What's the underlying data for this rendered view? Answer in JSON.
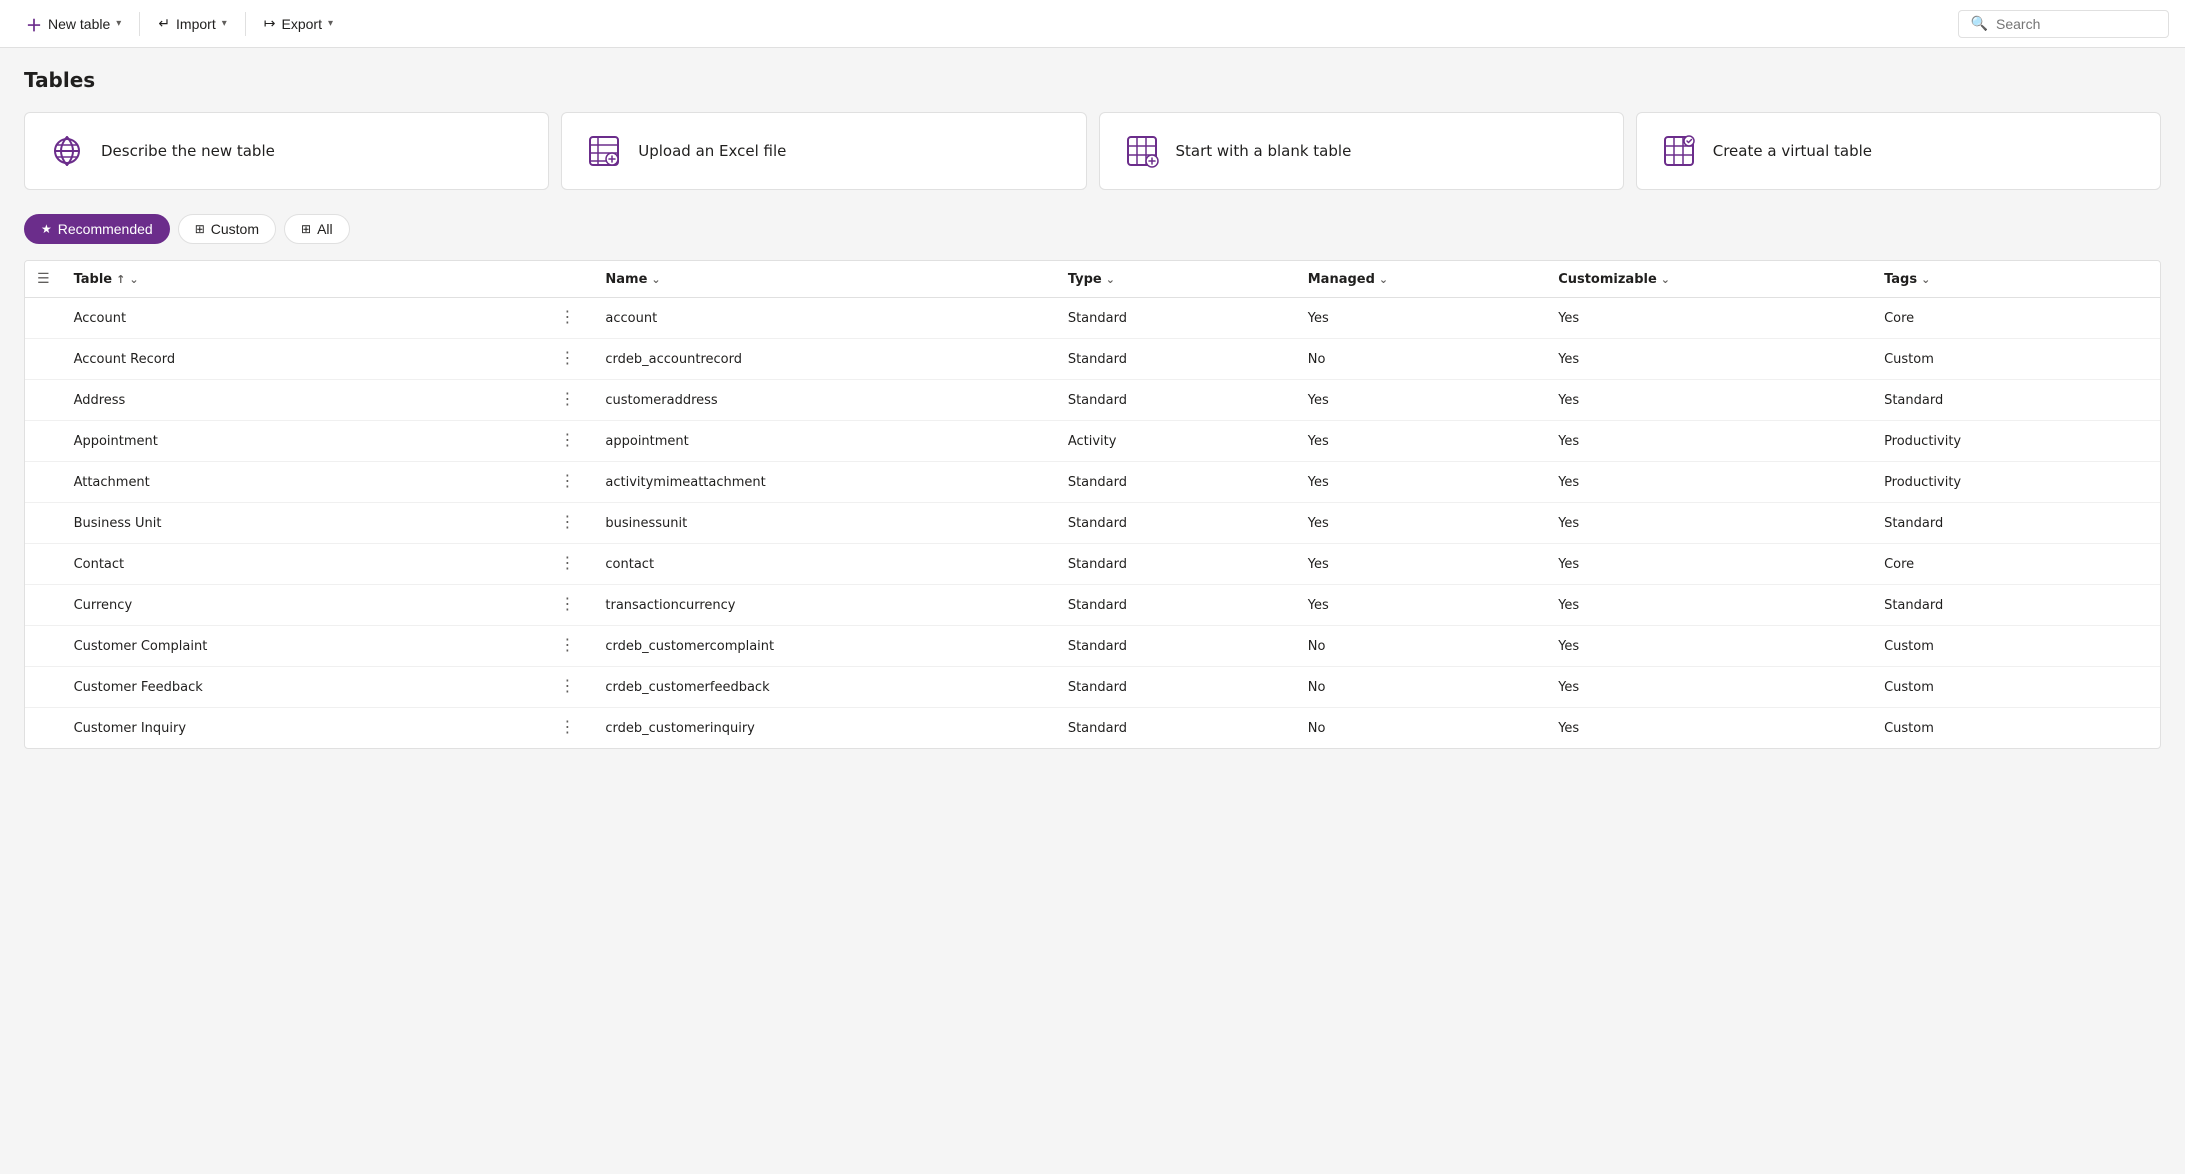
{
  "toolbar": {
    "new_table_label": "New table",
    "import_label": "Import",
    "export_label": "Export",
    "search_placeholder": "Search"
  },
  "page": {
    "title": "Tables"
  },
  "cards": [
    {
      "id": "describe",
      "label": "Describe the new table",
      "icon": "ai-icon"
    },
    {
      "id": "upload",
      "label": "Upload an Excel file",
      "icon": "excel-icon"
    },
    {
      "id": "blank",
      "label": "Start with a blank table",
      "icon": "blank-table-icon"
    },
    {
      "id": "virtual",
      "label": "Create a virtual table",
      "icon": "virtual-table-icon"
    }
  ],
  "filters": [
    {
      "id": "recommended",
      "label": "Recommended",
      "active": true
    },
    {
      "id": "custom",
      "label": "Custom",
      "active": false
    },
    {
      "id": "all",
      "label": "All",
      "active": false
    }
  ],
  "table": {
    "columns": [
      {
        "id": "table",
        "label": "Table",
        "sortable": true,
        "sort_dir": "asc"
      },
      {
        "id": "name",
        "label": "Name",
        "sortable": true
      },
      {
        "id": "type",
        "label": "Type",
        "sortable": true
      },
      {
        "id": "managed",
        "label": "Managed",
        "sortable": true
      },
      {
        "id": "customizable",
        "label": "Customizable",
        "sortable": true
      },
      {
        "id": "tags",
        "label": "Tags",
        "sortable": true
      }
    ],
    "rows": [
      {
        "table": "Account",
        "name": "account",
        "type": "Standard",
        "managed": "Yes",
        "customizable": "Yes",
        "tags": "Core"
      },
      {
        "table": "Account Record",
        "name": "crdeb_accountrecord",
        "type": "Standard",
        "managed": "No",
        "customizable": "Yes",
        "tags": "Custom"
      },
      {
        "table": "Address",
        "name": "customeraddress",
        "type": "Standard",
        "managed": "Yes",
        "customizable": "Yes",
        "tags": "Standard"
      },
      {
        "table": "Appointment",
        "name": "appointment",
        "type": "Activity",
        "managed": "Yes",
        "customizable": "Yes",
        "tags": "Productivity"
      },
      {
        "table": "Attachment",
        "name": "activitymimeattachment",
        "type": "Standard",
        "managed": "Yes",
        "customizable": "Yes",
        "tags": "Productivity"
      },
      {
        "table": "Business Unit",
        "name": "businessunit",
        "type": "Standard",
        "managed": "Yes",
        "customizable": "Yes",
        "tags": "Standard"
      },
      {
        "table": "Contact",
        "name": "contact",
        "type": "Standard",
        "managed": "Yes",
        "customizable": "Yes",
        "tags": "Core"
      },
      {
        "table": "Currency",
        "name": "transactioncurrency",
        "type": "Standard",
        "managed": "Yes",
        "customizable": "Yes",
        "tags": "Standard"
      },
      {
        "table": "Customer Complaint",
        "name": "crdeb_customercomplaint",
        "type": "Standard",
        "managed": "No",
        "customizable": "Yes",
        "tags": "Custom"
      },
      {
        "table": "Customer Feedback",
        "name": "crdeb_customerfeedback",
        "type": "Standard",
        "managed": "No",
        "customizable": "Yes",
        "tags": "Custom"
      },
      {
        "table": "Customer Inquiry",
        "name": "crdeb_customerinquiry",
        "type": "Standard",
        "managed": "No",
        "customizable": "Yes",
        "tags": "Custom"
      }
    ]
  },
  "colors": {
    "brand": "#6b2d8b",
    "brand_light": "#f3e8f9"
  }
}
